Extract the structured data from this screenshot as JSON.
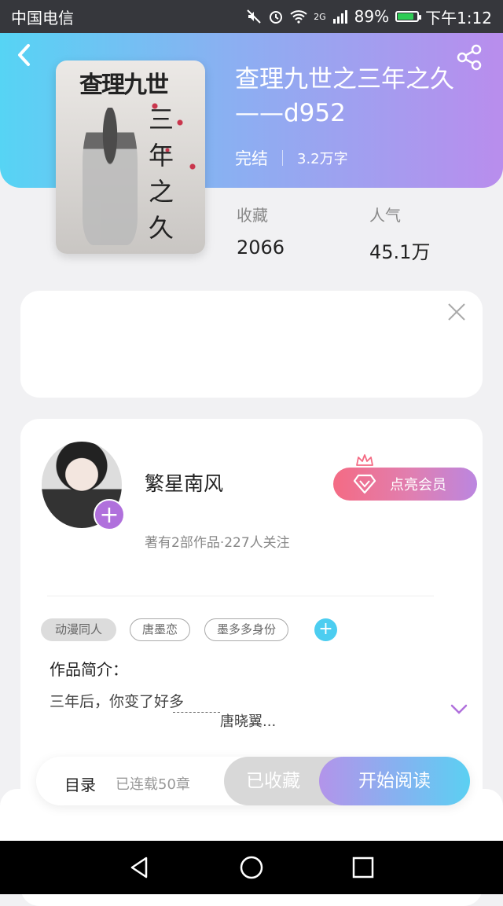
{
  "status_bar": {
    "carrier": "中国电信",
    "network": "2G",
    "battery": "89%",
    "battery_level": 0.89,
    "time": "下午1:12"
  },
  "header": {
    "back_icon": "chevron-left-icon",
    "share_icon": "share-icon",
    "gradient": [
      "#56d4f4",
      "#b98ded"
    ]
  },
  "book": {
    "cover_title_horizontal": "查理九世",
    "cover_title_vertical": "三年之久",
    "title": "查理九世之三年之久——d952",
    "status": "完结",
    "word_count": "3.2万字",
    "stats": [
      {
        "label": "收藏",
        "value": "2066"
      },
      {
        "label": "人气",
        "value": "45.1万"
      }
    ]
  },
  "ad": {
    "close_icon": "close-icon"
  },
  "author": {
    "name": "繁星南风",
    "stats": "著有2部作品·227人关注",
    "follow_icon": "plus-icon",
    "vip_label": "点亮会员",
    "vip_gradient": [
      "#f46b84",
      "#bb86e0"
    ]
  },
  "tags": [
    {
      "label": "动漫同人",
      "style": "filled"
    },
    {
      "label": "唐墨恋",
      "style": "outline"
    },
    {
      "label": "墨多多身份",
      "style": "outline"
    }
  ],
  "intro": {
    "label": "作品简介：",
    "line1": "三年后，你变了好多",
    "line2": "唐晓翼..."
  },
  "bottom_bar": {
    "toc_label": "目录",
    "chapters": "已连载50章",
    "collected_label": "已收藏",
    "read_label": "开始阅读"
  },
  "nav": {
    "icons": [
      "back-triangle-icon",
      "home-circle-icon",
      "recent-square-icon"
    ]
  }
}
